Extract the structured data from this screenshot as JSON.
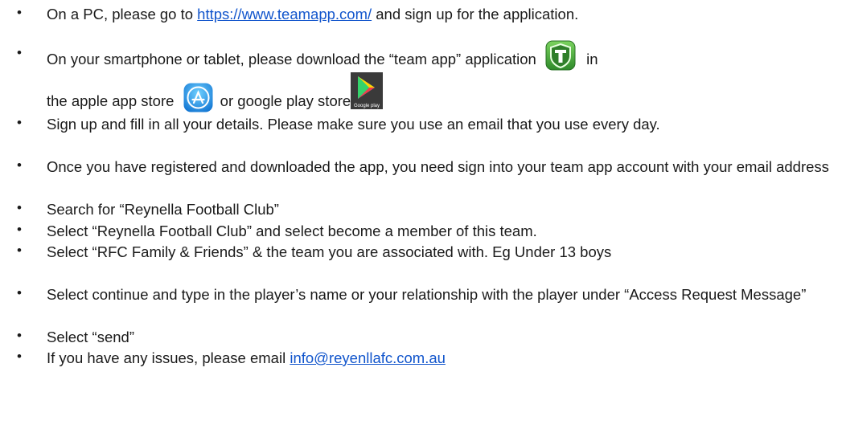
{
  "bullet_glyph": "•",
  "items": [
    {
      "before": "On a PC, please go to ",
      "link": "https://www.teamapp.com/",
      "after": " and sign up for the application."
    },
    {
      "line1_before": "On your smartphone or tablet, please download the “team app” application ",
      "line1_after": " in",
      "line2_before": "the apple app store ",
      "line2_middle": " or google play store",
      "icons": [
        "team-app-icon",
        "app-store-icon",
        "google-play-icon"
      ]
    },
    {
      "text": "Sign up and fill in all your details. Please make sure you use an email that you use every day."
    },
    {
      "text": "Once you have registered and downloaded the app, you need sign into your team app account with your email address"
    },
    {
      "text": "Search for “Reynella Football Club”"
    },
    {
      "text": "Select “Reynella Football Club” and select become a member of this team."
    },
    {
      "text": "Select “RFC Family & Friends” & the team you are associated with. Eg Under 13 boys"
    },
    {
      "text": "Select continue and type in the player’s name or your relationship with the player under “Access Request Message”"
    },
    {
      "text": "Select “send”"
    },
    {
      "before": "If you have any issues, please email ",
      "link": "info@reyenllafc.com.au"
    }
  ],
  "google_play_label": "Google play",
  "colors": {
    "link": "#1155cc",
    "teamapp_green": "#3aa335",
    "appstore_blue": "#1d9bf0"
  }
}
